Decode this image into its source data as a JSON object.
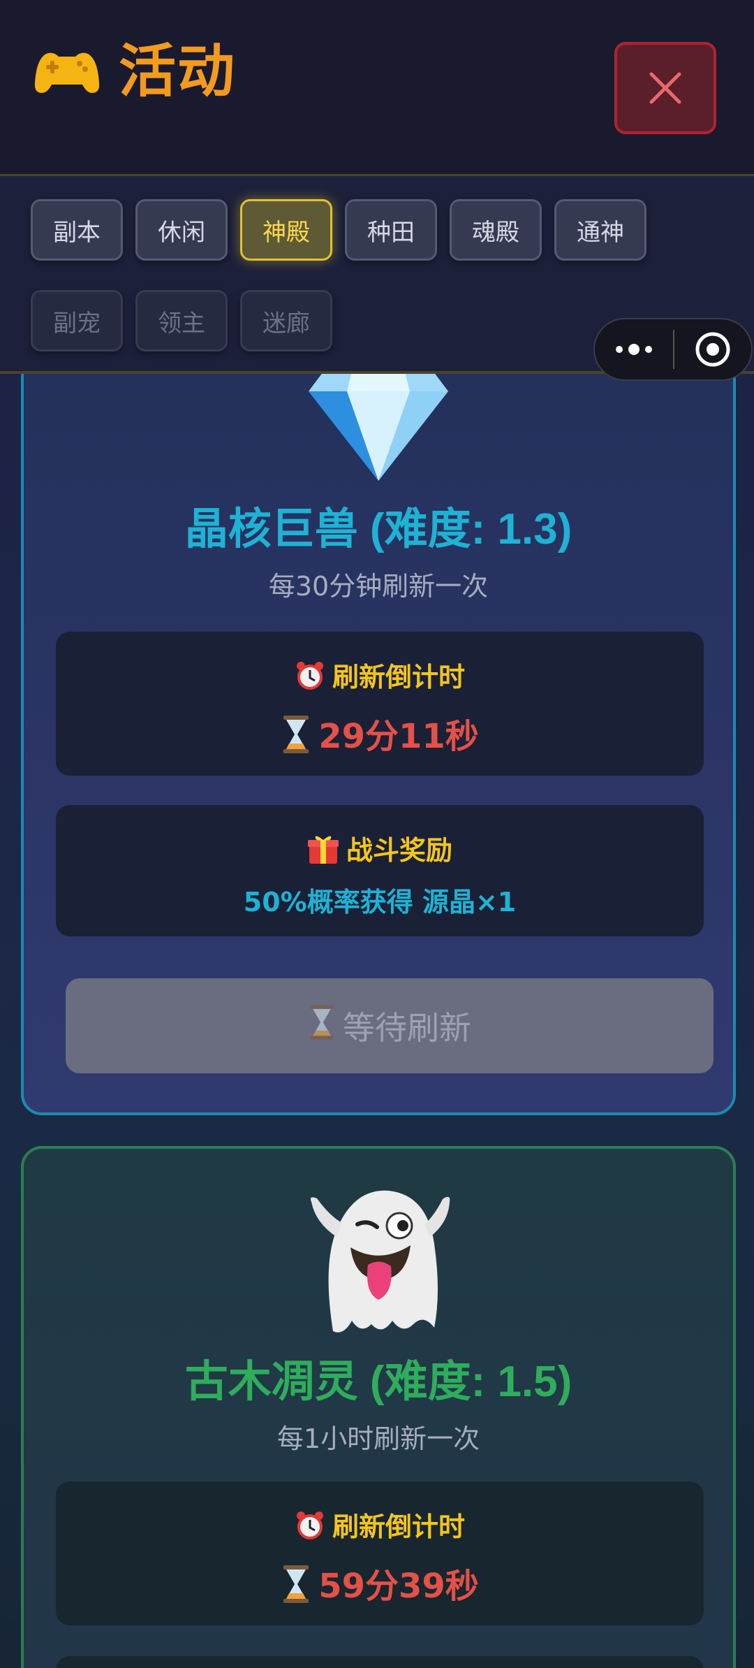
{
  "header": {
    "title": "活动",
    "icon": "gamepad-icon",
    "close_icon": "close-icon"
  },
  "tabs": {
    "row1": [
      {
        "label": "副本",
        "state": "normal"
      },
      {
        "label": "休闲",
        "state": "normal"
      },
      {
        "label": "神殿",
        "state": "active"
      },
      {
        "label": "种田",
        "state": "normal"
      },
      {
        "label": "魂殿",
        "state": "normal"
      },
      {
        "label": "通神",
        "state": "normal"
      }
    ],
    "row2": [
      {
        "label": "副宠",
        "state": "disabled"
      },
      {
        "label": "领主",
        "state": "disabled"
      },
      {
        "label": "迷廊",
        "state": "disabled"
      }
    ]
  },
  "capsule": {
    "more_icon": "more-dots-icon",
    "close_icon": "target-circle-icon"
  },
  "cards": [
    {
      "icon": "diamond-icon",
      "name": "晶核巨兽 (难度: 1.3)",
      "name_color": "#1eb2d4",
      "refresh": "每30分钟刷新一次",
      "countdown_title": "刷新倒计时",
      "countdown_value": "29分11秒",
      "reward_title": "战斗奖励",
      "reward_value": "50%概率获得 源晶×1",
      "button_label": "等待刷新"
    },
    {
      "icon": "ghost-icon",
      "name": "古木凋灵 (难度: 1.5)",
      "name_color": "#2ead5c",
      "refresh": "每1小时刷新一次",
      "countdown_title": "刷新倒计时",
      "countdown_value": "59分39秒"
    }
  ],
  "colors": {
    "accent_orange": "#f39a1f",
    "active_tab": "#e2c22c",
    "countdown_red": "#e35147",
    "reward_cyan": "#1eb2d4"
  }
}
